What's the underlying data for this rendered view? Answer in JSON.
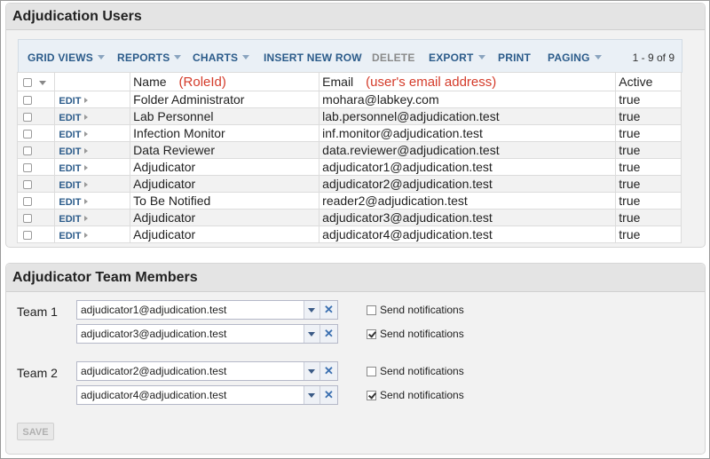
{
  "users_panel": {
    "title": "Adjudication Users",
    "toolbar": {
      "grid_views": "GRID VIEWS",
      "reports": "REPORTS",
      "charts": "CHARTS",
      "insert_new_row": "INSERT NEW ROW",
      "delete": "DELETE",
      "export": "EXPORT",
      "print": "PRINT",
      "paging": "PAGING",
      "count": "1 - 9 of 9"
    },
    "columns": {
      "name": "Name",
      "name_note": "(RoleId)",
      "email": "Email",
      "email_note": "(user's email address)",
      "active": "Active"
    },
    "edit_label": "EDIT",
    "rows": [
      {
        "name": "Folder Administrator",
        "email": "mohara@labkey.com",
        "active": "true"
      },
      {
        "name": "Lab Personnel",
        "email": "lab.personnel@adjudication.test",
        "active": "true"
      },
      {
        "name": "Infection Monitor",
        "email": "inf.monitor@adjudication.test",
        "active": "true"
      },
      {
        "name": "Data Reviewer",
        "email": "data.reviewer@adjudication.test",
        "active": "true"
      },
      {
        "name": "Adjudicator",
        "email": "adjudicator1@adjudication.test",
        "active": "true"
      },
      {
        "name": "Adjudicator",
        "email": "adjudicator2@adjudication.test",
        "active": "true"
      },
      {
        "name": "To Be Notified",
        "email": "reader2@adjudication.test",
        "active": "true"
      },
      {
        "name": "Adjudicator",
        "email": "adjudicator3@adjudication.test",
        "active": "true"
      },
      {
        "name": "Adjudicator",
        "email": "adjudicator4@adjudication.test",
        "active": "true"
      }
    ]
  },
  "team_panel": {
    "title": "Adjudicator Team Members",
    "notify_label": "Send notifications",
    "teams": [
      {
        "label": "Team 1",
        "members": [
          {
            "value": "adjudicator1@adjudication.test",
            "notify": false
          },
          {
            "value": "adjudicator3@adjudication.test",
            "notify": true
          }
        ]
      },
      {
        "label": "Team 2",
        "members": [
          {
            "value": "adjudicator2@adjudication.test",
            "notify": false
          },
          {
            "value": "adjudicator4@adjudication.test",
            "notify": true
          }
        ]
      }
    ],
    "save_label": "SAVE"
  },
  "colors": {
    "link": "#2b5b8a",
    "annotation": "#d43b2a"
  }
}
